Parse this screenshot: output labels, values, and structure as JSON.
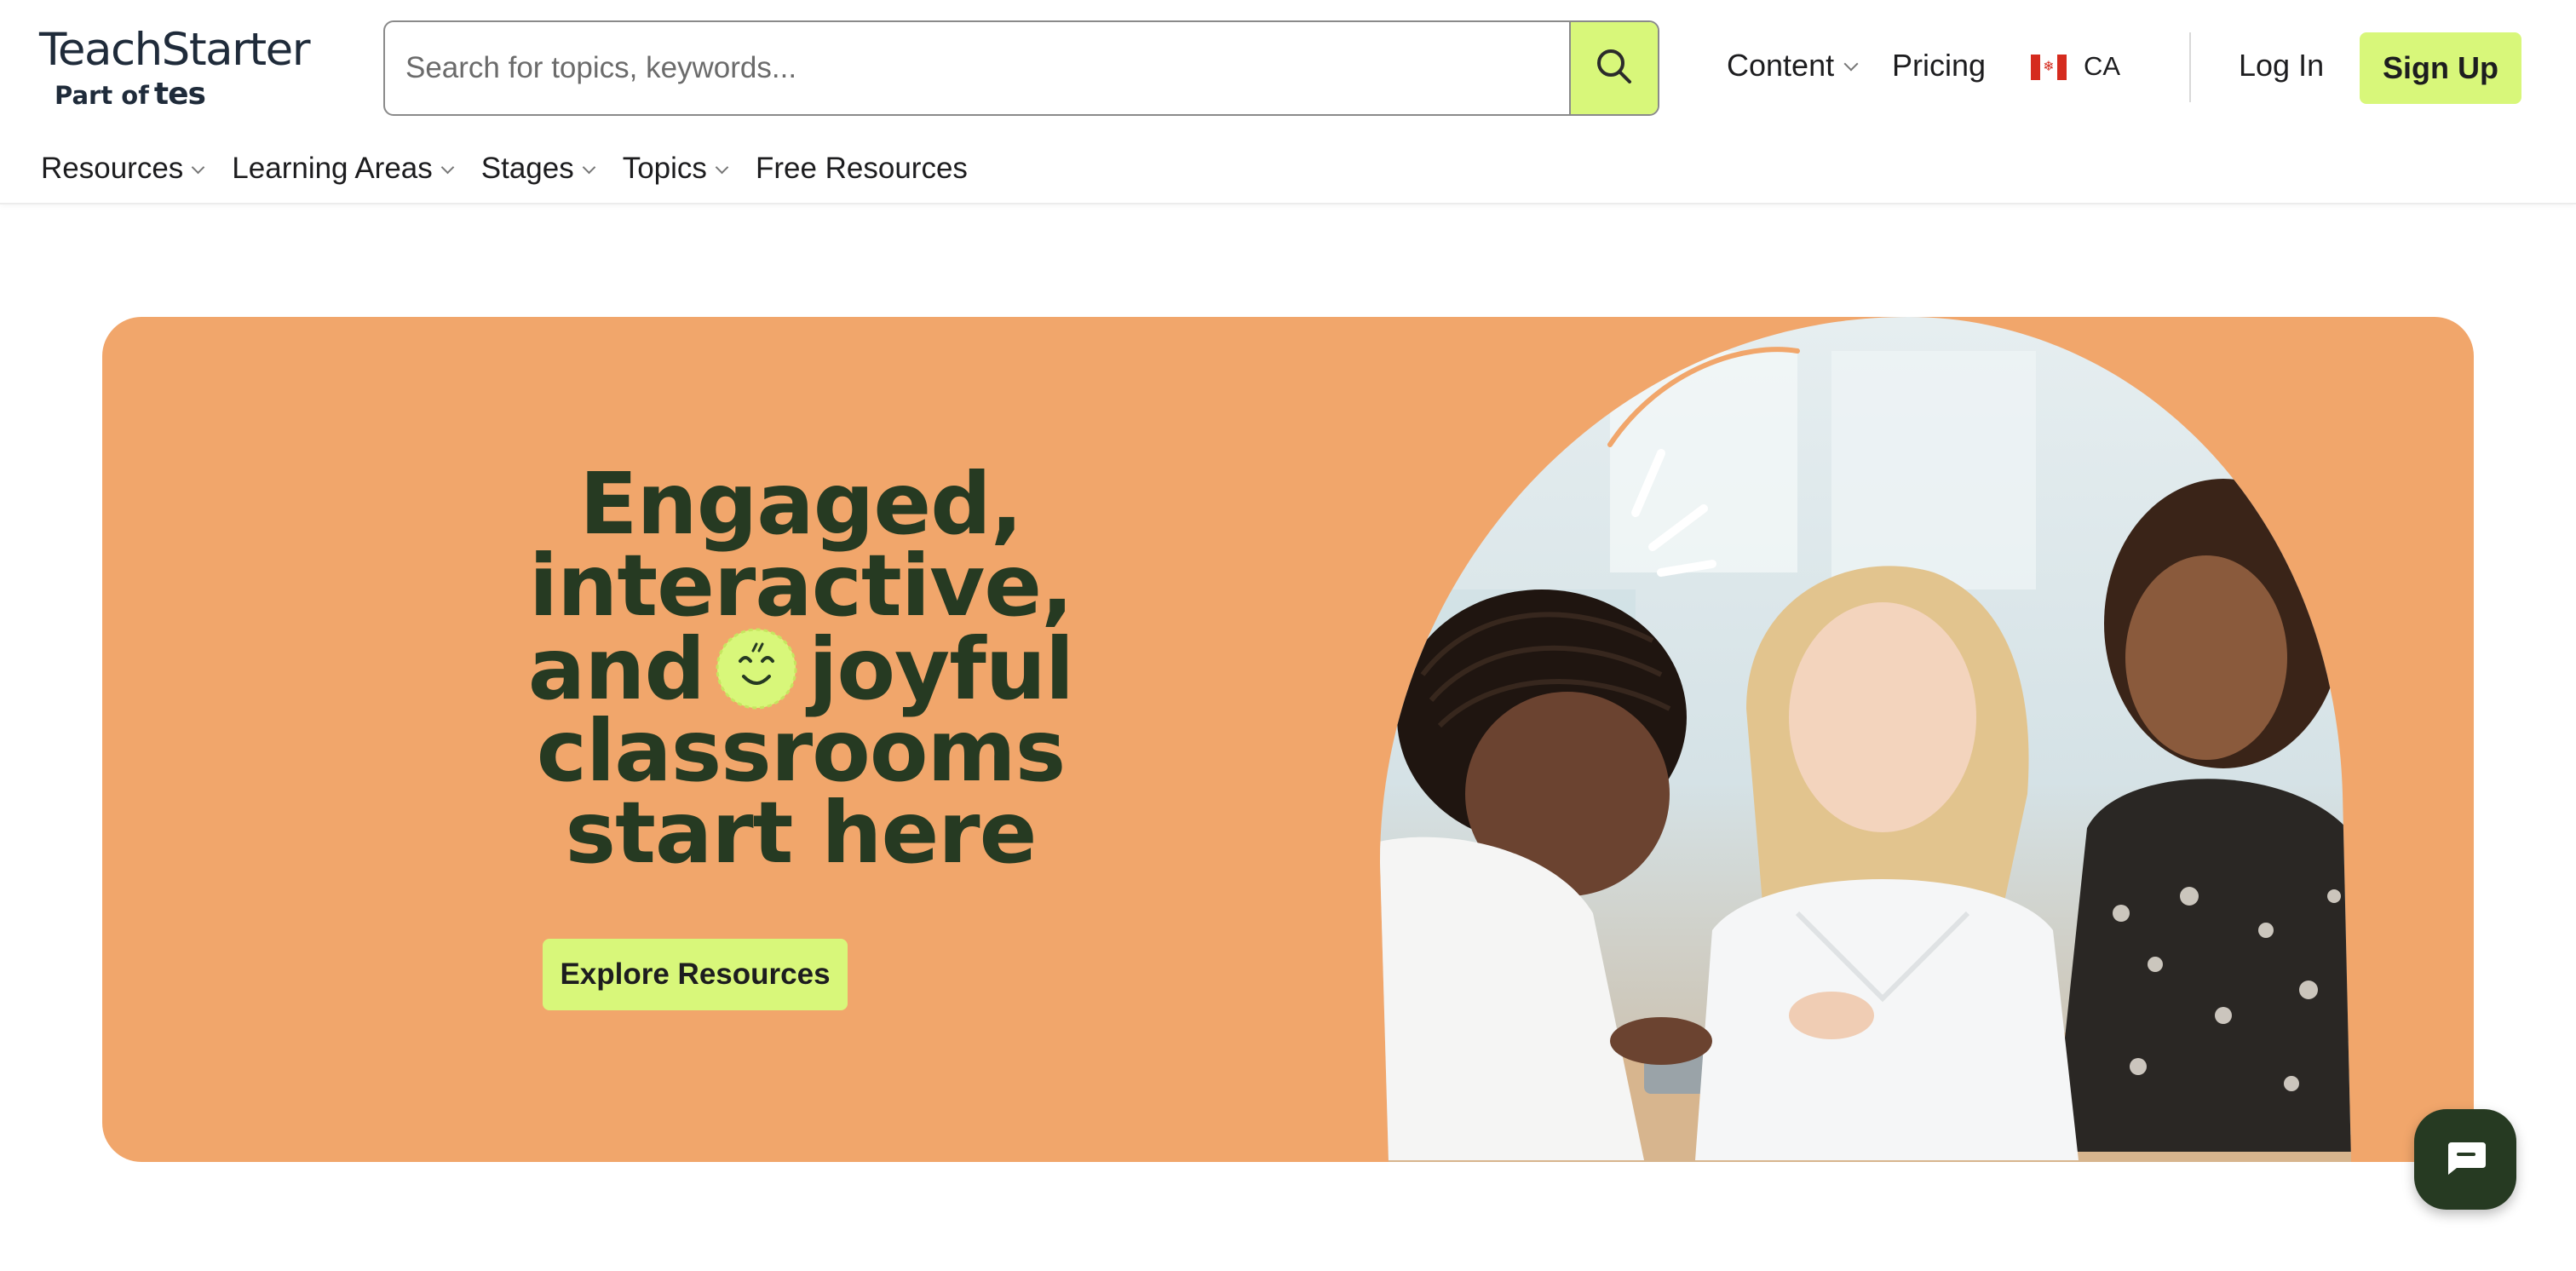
{
  "brand": {
    "name": "TeachStarter",
    "part_of": "Part of",
    "parent": "tes"
  },
  "search": {
    "placeholder": "Search for topics, keywords..."
  },
  "topnav": {
    "content": "Content",
    "pricing": "Pricing",
    "country": "CA",
    "login": "Log In",
    "signup": "Sign Up"
  },
  "subnav": [
    {
      "label": "Resources",
      "has_dropdown": true
    },
    {
      "label": "Learning Areas",
      "has_dropdown": true
    },
    {
      "label": "Stages",
      "has_dropdown": true
    },
    {
      "label": "Topics",
      "has_dropdown": true
    },
    {
      "label": "Free Resources",
      "has_dropdown": false
    }
  ],
  "hero": {
    "line1": "Engaged,",
    "line2": "interactive,",
    "line3a": "and",
    "line3b": "joyful",
    "line4": "classrooms",
    "line5": "start here",
    "cta": "Explore Resources"
  },
  "colors": {
    "accent_lime": "#d8f77a",
    "hero_bg": "#f1a66b",
    "dark_green": "#263a22",
    "navy": "#1f2b3a"
  },
  "icons": {
    "search": "search-icon",
    "chevron": "chevron-down-icon",
    "flag": "canada-flag-icon",
    "smiley": "smiley-icon",
    "chat": "chat-icon"
  }
}
